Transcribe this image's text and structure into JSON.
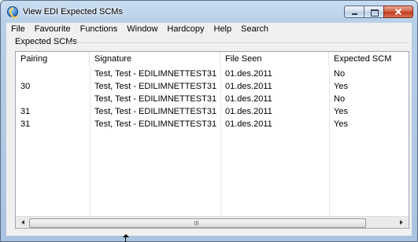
{
  "window": {
    "title": "View EDI Expected SCMs"
  },
  "menu": [
    "File",
    "Favourite",
    "Functions",
    "Window",
    "Hardcopy",
    "Help",
    "Search"
  ],
  "section": {
    "label": "Expected SCMs"
  },
  "table": {
    "columns": [
      "Pairing",
      "Signature",
      "File Seen",
      "Expected SCM"
    ],
    "rows": [
      [
        "",
        "Test, Test - EDILIMNETTEST31",
        "01.des.2011",
        "No"
      ],
      [
        "30",
        "Test, Test - EDILIMNETTEST31",
        "01.des.2011",
        "Yes"
      ],
      [
        "",
        "Test, Test - EDILIMNETTEST31",
        "01.des.2011",
        "No"
      ],
      [
        "31",
        "Test, Test - EDILIMNETTEST31",
        "01.des.2011",
        "Yes"
      ],
      [
        "31",
        "Test, Test - EDILIMNETTEST31",
        "01.des.2011",
        "Yes"
      ]
    ]
  },
  "icons": {
    "app": "app-globe-icon",
    "minimize": "minimize-icon",
    "maximize": "maximize-icon",
    "close": "close-icon",
    "scroll_left": "arrow-left-icon",
    "scroll_right": "arrow-right-icon",
    "cursor": "resize-cursor-icon"
  },
  "colors": {
    "frame": "#b6cee8",
    "close_button": "#c0391c",
    "panel": "#f0f0f0"
  }
}
